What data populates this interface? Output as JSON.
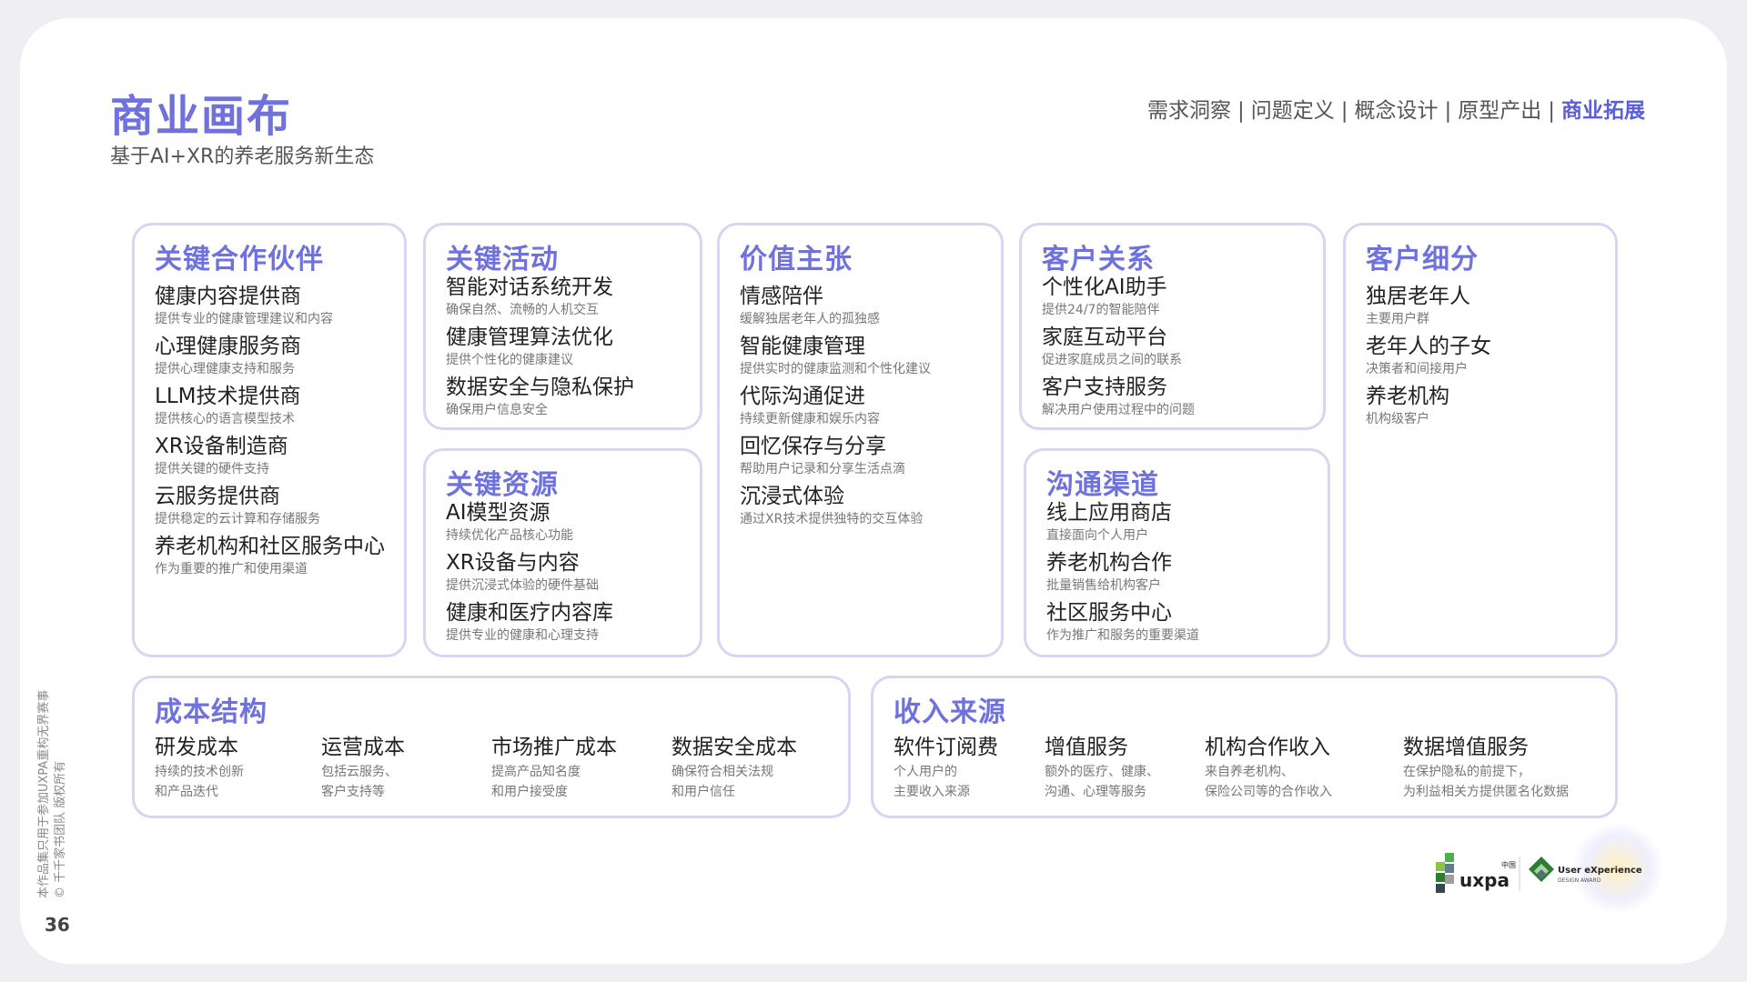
{
  "header": {
    "title": "商业画布",
    "subtitle": "基于AI+XR的养老服务新生态",
    "nav": [
      "需求洞察",
      "问题定义",
      "概念设计",
      "原型产出",
      "商业拓展"
    ],
    "nav_active_index": 4
  },
  "canvas": {
    "partners": {
      "title": "关键合作伙伴",
      "items": [
        {
          "name": "健康内容提供商",
          "desc": "提供专业的健康管理建议和内容"
        },
        {
          "name": "心理健康服务商",
          "desc": "提供心理健康支持和服务"
        },
        {
          "name": "LLM技术提供商",
          "desc": "提供核心的语言模型技术"
        },
        {
          "name": "XR设备制造商",
          "desc": "提供关键的硬件支持"
        },
        {
          "name": "云服务提供商",
          "desc": "提供稳定的云计算和存储服务"
        },
        {
          "name": "养老机构和社区服务中心",
          "desc": "作为重要的推广和使用渠道"
        }
      ]
    },
    "activities": {
      "title": "关键活动",
      "items": [
        {
          "name": "智能对话系统开发",
          "desc": "确保自然、流畅的人机交互"
        },
        {
          "name": "健康管理算法优化",
          "desc": "提供个性化的健康建议"
        },
        {
          "name": "数据安全与隐私保护",
          "desc": "确保用户信息安全"
        }
      ]
    },
    "resources": {
      "title": "关键资源",
      "items": [
        {
          "name": "AI模型资源",
          "desc": "持续优化产品核心功能"
        },
        {
          "name": "XR设备与内容",
          "desc": "提供沉浸式体验的硬件基础"
        },
        {
          "name": "健康和医疗内容库",
          "desc": "提供专业的健康和心理支持"
        }
      ]
    },
    "value": {
      "title": "价值主张",
      "items": [
        {
          "name": "情感陪伴",
          "desc": "缓解独居老年人的孤独感"
        },
        {
          "name": "智能健康管理",
          "desc": "提供实时的健康监测和个性化建议"
        },
        {
          "name": "代际沟通促进",
          "desc": "持续更新健康和娱乐内容"
        },
        {
          "name": "回忆保存与分享",
          "desc": "帮助用户记录和分享生活点滴"
        },
        {
          "name": "沉浸式体验",
          "desc": "通过XR技术提供独特的交互体验"
        }
      ]
    },
    "relationships": {
      "title": "客户关系",
      "items": [
        {
          "name": "个性化AI助手",
          "desc": "提供24/7的智能陪伴"
        },
        {
          "name": "家庭互动平台",
          "desc": "促进家庭成员之间的联系"
        },
        {
          "name": "客户支持服务",
          "desc": "解决用户使用过程中的问题"
        }
      ]
    },
    "channels": {
      "title": "沟通渠道",
      "items": [
        {
          "name": "线上应用商店",
          "desc": "直接面向个人用户"
        },
        {
          "name": "养老机构合作",
          "desc": "批量销售给机构客户"
        },
        {
          "name": "社区服务中心",
          "desc": "作为推广和服务的重要渠道"
        }
      ]
    },
    "segments": {
      "title": "客户细分",
      "items": [
        {
          "name": "独居老年人",
          "desc": "主要用户群"
        },
        {
          "name": "老年人的子女",
          "desc": "决策者和间接用户"
        },
        {
          "name": "养老机构",
          "desc": "机构级客户"
        }
      ]
    },
    "costs": {
      "title": "成本结构",
      "items": [
        {
          "name": "研发成本",
          "desc1": "持续的技术创新",
          "desc2": "和产品迭代"
        },
        {
          "name": "运营成本",
          "desc1": "包括云服务、",
          "desc2": "客户支持等"
        },
        {
          "name": "市场推广成本",
          "desc1": "提高产品知名度",
          "desc2": "和用户接受度"
        },
        {
          "name": "数据安全成本",
          "desc1": "确保符合相关法规",
          "desc2": "和用户信任"
        }
      ]
    },
    "revenue": {
      "title": "收入来源",
      "items": [
        {
          "name": "软件订阅费",
          "desc1": "个人用户的",
          "desc2": "主要收入来源"
        },
        {
          "name": "增值服务",
          "desc1": "额外的医疗、健康、",
          "desc2": "沟通、心理等服务"
        },
        {
          "name": "机构合作收入",
          "desc1": "来自养老机构、",
          "desc2": "保险公司等的合作收入"
        },
        {
          "name": "数据增值服务",
          "desc1": "在保护隐私的前提下，",
          "desc2": "为利益相关方提供匿名化数据"
        }
      ]
    }
  },
  "footer": {
    "side_note_line1": "本作品集只用于参加UXPA重构无界赛事",
    "side_note_line2": "© 千千家书团队 版权所有",
    "page_number": "36",
    "logo_uxpa_text": "uxpa",
    "logo_uxpa_cn": "中国",
    "logo_award_line1": "User eXperience",
    "logo_award_line2": "DESIGN AWARD"
  }
}
